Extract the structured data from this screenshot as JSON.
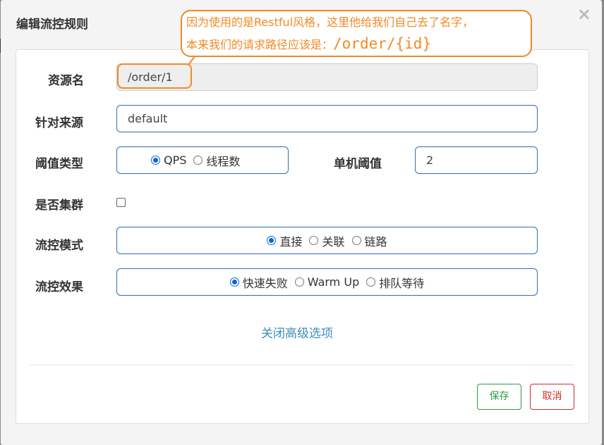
{
  "dialog": {
    "title": "编辑流控规则",
    "close_label": "×"
  },
  "annotation": {
    "line1": "因为使用的是Restful风格，这里他给我们自己去了名字，",
    "line2_prefix": "本来我们的请求路径应该是：",
    "line2_code": "/order/{id}",
    "color": "#f08a24"
  },
  "form": {
    "resource": {
      "label": "资源名",
      "value": "/order/1"
    },
    "origin": {
      "label": "针对来源",
      "value": "default"
    },
    "threshold_type": {
      "label": "阈值类型",
      "options": [
        {
          "label": "QPS",
          "checked": true
        },
        {
          "label": "线程数",
          "checked": false
        }
      ]
    },
    "single_threshold": {
      "label": "单机阈值",
      "value": "2"
    },
    "cluster": {
      "label": "是否集群",
      "checked": false
    },
    "flow_mode": {
      "label": "流控模式",
      "options": [
        {
          "label": "直接",
          "checked": true
        },
        {
          "label": "关联",
          "checked": false
        },
        {
          "label": "链路",
          "checked": false
        }
      ]
    },
    "flow_effect": {
      "label": "流控效果",
      "options": [
        {
          "label": "快速失败",
          "checked": true
        },
        {
          "label": "Warm Up",
          "checked": false
        },
        {
          "label": "排队等待",
          "checked": false
        }
      ]
    },
    "advanced_link": "关闭高级选项"
  },
  "buttons": {
    "save": "保存",
    "cancel": "取消"
  }
}
